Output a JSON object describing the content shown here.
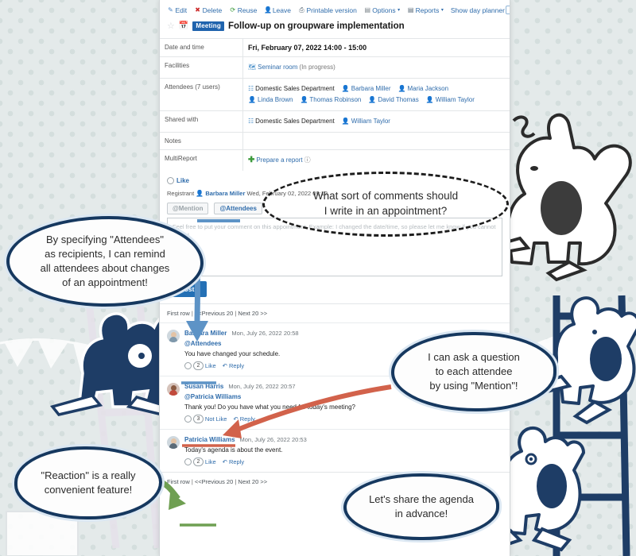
{
  "toolbar": {
    "items": [
      {
        "label": "Edit",
        "icon": "edit-icon",
        "glyph": "✎"
      },
      {
        "label": "Delete",
        "icon": "delete-icon",
        "glyph": "✖"
      },
      {
        "label": "Reuse",
        "icon": "reuse-icon",
        "glyph": "⟳"
      },
      {
        "label": "Leave",
        "icon": "leave-icon",
        "glyph": "⛓"
      },
      {
        "label": "Printable version",
        "icon": "printer-icon",
        "glyph": "⎙"
      },
      {
        "label": "Options",
        "icon": "options-icon",
        "glyph": "☰",
        "caret": "▾"
      },
      {
        "label": "Reports",
        "icon": "reports-icon",
        "glyph": "▤",
        "caret": "▾"
      },
      {
        "label": "Show day planner",
        "icon": "day-planner-icon",
        "glyph": "↓"
      }
    ]
  },
  "header": {
    "star_icon": "☆",
    "calendar_icon": "Ὄ5",
    "badge": "Meeting",
    "title": "Follow-up on groupware implementation"
  },
  "details": {
    "rows": [
      {
        "label": "Date and time",
        "type": "datetime",
        "value": "Fri, February 07, 2022   14:00  -  15:00"
      },
      {
        "label": "Facilities",
        "type": "facility",
        "facility": "Seminar room",
        "status": "(In progress)"
      },
      {
        "label": "Attendees (7 users)",
        "type": "people",
        "org": "Domestic Sales Department",
        "people": [
          "Barbara Miller",
          "Maria Jackson",
          "Linda Brown",
          "Thomas Robinson",
          "David Thomas",
          "William Taylor"
        ]
      },
      {
        "label": "Shared with",
        "type": "people",
        "org": "Domestic Sales Department",
        "people": [
          "William Taylor"
        ]
      },
      {
        "label": "Notes",
        "type": "empty",
        "value": ""
      },
      {
        "label": "MultiReport",
        "type": "action",
        "action": "Prepare a report",
        "help": "ⓘ"
      }
    ]
  },
  "like_bar": {
    "label": "Like"
  },
  "registrant": {
    "label": "Registrant",
    "name": "Barbara Miller",
    "date": "Wed, February 02, 2022 09:12"
  },
  "comment_form": {
    "mention_button": "@Mention",
    "attendees_button": "@Attendees",
    "placeholder": "Feel free to put your comment on this appointment.\nExample: I changed the date/time, so please let me know if you cannot attend.",
    "post_label": "Post"
  },
  "pager": {
    "first": "First row",
    "previous": "<<Previous 20",
    "next": "Next 20 >>",
    "sep": "|"
  },
  "comments": [
    {
      "author": "Barbara Miller",
      "timestamp": "Mon, July 26, 2022 20:58",
      "mention": "@Attendees",
      "text": "You have changed your schedule.",
      "reaction_count": "2",
      "reaction_label": "Like",
      "reply_label": "Reply"
    },
    {
      "author": "Susan Harris",
      "timestamp": "Mon, July 26, 2022 20:57",
      "mention": "@Patricia Williams",
      "text": "Thank you! Do you have what you need for today's meeting?",
      "reaction_count": "3",
      "reaction_label": "Not Like",
      "reply_label": "Reply"
    },
    {
      "author": "Patricia Williams",
      "timestamp": "Mon, July 26, 2022 20:53",
      "mention": "",
      "text": "Today's agenda is about the event.",
      "reaction_count": "2",
      "reaction_label": "Like",
      "reply_label": "Reply"
    }
  ],
  "bubbles": {
    "question": {
      "line1": "What sort of comments should",
      "line2": "I write in an appointment?"
    },
    "attendees": {
      "line1": "By specifying \"Attendees\"",
      "line2": "as recipients, I can remind",
      "line3": "all attendees about changes",
      "line4": "of an appointment!"
    },
    "mention": {
      "line1": "I can ask a question",
      "line2": "to each attendee",
      "line3": "by using \"Mention\"!"
    },
    "reaction": {
      "line1": "\"Reaction\" is a really",
      "line2": "convenient feature!"
    },
    "agenda": {
      "line1": "Let's share the agenda",
      "line2": "in advance!"
    }
  },
  "colors": {
    "accent_blue": "#2f6cab",
    "badge_blue": "#1f63ad",
    "post_blue": "#2470b5",
    "bubble_outline": "#16385f",
    "arrow_blue": "#5d93c6",
    "arrow_red": "#d2624b",
    "arrow_green": "#6f9f52",
    "background": "#e4eaea"
  }
}
